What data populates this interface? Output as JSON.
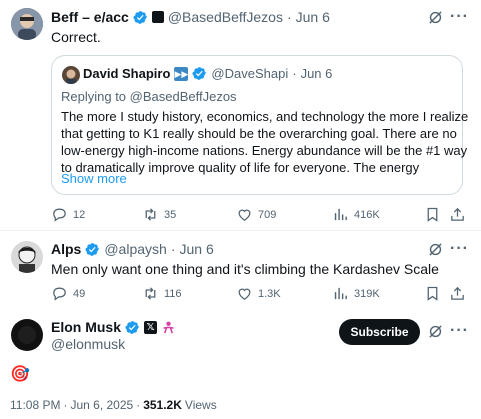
{
  "tweet1": {
    "display_name": "Beff – e/acc",
    "handle": "@BasedBeffJezos",
    "separator": "·",
    "date": "Jun 6",
    "text": "Correct.",
    "actions": {
      "replies": "12",
      "reposts": "35",
      "likes": "709",
      "views": "416K"
    }
  },
  "quote": {
    "display_name": "David Shapiro",
    "handle": "@DaveShapi",
    "separator": "·",
    "date": "Jun 6",
    "replying_to": "Replying to @BasedBeffJezos",
    "lines": [
      "The more I study history, economics, and technology the more I realize",
      "that getting to K1 really should be the overarching goal. There are no",
      "low-energy high-income nations. Energy abundance will be the #1 way",
      "to dramatically improve quality of life for everyone. The energy"
    ],
    "show_more": "Show more"
  },
  "tweet2": {
    "display_name": "Alps",
    "handle": "@alpaysh",
    "separator": "·",
    "date": "Jun 6",
    "text": "Men only want one thing and it's climbing the Kardashev Scale",
    "actions": {
      "replies": "49",
      "reposts": "116",
      "likes": "1.3K",
      "views": "319K"
    }
  },
  "main": {
    "display_name": "Elon Musk",
    "handle": "@elonmusk",
    "subscribe_label": "Subscribe",
    "emoji": "🎯",
    "time": "11:08 PM",
    "date": "Jun 6, 2025",
    "separator": "·",
    "views_count": "351.2K",
    "views_label": "Views"
  },
  "colors": {
    "accent": "#1d9bf0",
    "muted": "#536471",
    "border": "#cfd9de",
    "text": "#0f1419"
  }
}
